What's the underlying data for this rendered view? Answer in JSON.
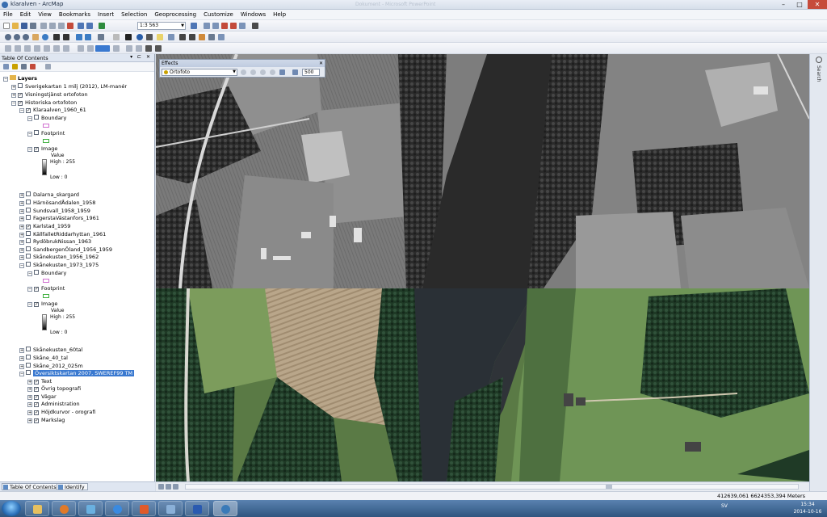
{
  "window": {
    "title": "klaralven - ArcMap",
    "ghost_title": "Dokument - Microsoft PowerPoint"
  },
  "menu": [
    "File",
    "Edit",
    "View",
    "Bookmarks",
    "Insert",
    "Selection",
    "Geoprocessing",
    "Customize",
    "Windows",
    "Help"
  ],
  "toolbar": {
    "scale": "1:3 563"
  },
  "toc": {
    "title": "Table Of Contents",
    "root": "Layers",
    "items": [
      {
        "label": "Sverigekartan 1 milj (2012), LM-manér",
        "checked": false
      },
      {
        "label": "Visningstjänst ortofoton",
        "checked": true
      },
      {
        "label": "Historiska ortofoton",
        "checked": true
      },
      {
        "label": "Klaraalven_1960_61",
        "checked": true
      },
      {
        "label": "Boundary",
        "checked": false
      },
      {
        "label": "Footprint",
        "checked": false
      },
      {
        "label": "Image",
        "checked": true
      },
      {
        "label": "Dalarna_skargard",
        "checked": false
      },
      {
        "label": "HärnösandÅdalen_1958",
        "checked": false
      },
      {
        "label": "Sundsvall_1958_1959",
        "checked": false
      },
      {
        "label": "FagerstaVästanfors_1961",
        "checked": false
      },
      {
        "label": "Karlstad_1959",
        "checked": true
      },
      {
        "label": "KällfalletRiddarhyttan_1961",
        "checked": false
      },
      {
        "label": "RydöbrukNissan_1963",
        "checked": false
      },
      {
        "label": "SandbergenÖland_1956_1959",
        "checked": false
      },
      {
        "label": "Skånekusten_1956_1962",
        "checked": false
      },
      {
        "label": "Skånekusten_1973_1975",
        "checked": false
      },
      {
        "label": "Boundary",
        "checked": false
      },
      {
        "label": "Footprint",
        "checked": true
      },
      {
        "label": "Image",
        "checked": true
      },
      {
        "label": "Skånekusten_60tal",
        "checked": false
      },
      {
        "label": "Skåne_40_tal",
        "checked": false
      },
      {
        "label": "Skåne_2012_025m",
        "checked": false
      },
      {
        "label": "Översiktskartan 2007, SWEREF99 TM",
        "checked": false
      },
      {
        "label": "Text",
        "checked": true
      },
      {
        "label": "Övrig topografi",
        "checked": true
      },
      {
        "label": "Vägar",
        "checked": true
      },
      {
        "label": "Administration",
        "checked": true
      },
      {
        "label": "Höjdkurvor - orografi",
        "checked": true
      },
      {
        "label": "Markslag",
        "checked": true
      }
    ],
    "legend": {
      "value": "Value",
      "high": "High : 255",
      "low": "Low : 0"
    },
    "tabs": [
      "Table Of Contents",
      "Identify"
    ]
  },
  "effects": {
    "title": "Effects",
    "layer": "Ortofoto",
    "value": "500"
  },
  "right_panel": {
    "label": "Search"
  },
  "status": {
    "coordinates": "412639,061  6624353,394 Meters"
  },
  "taskbar": {
    "lang": "SV",
    "time": "15:34",
    "date": "2014-10-16"
  },
  "colors": {
    "selection": "#3a79d0",
    "boundary_symbol": "#d070d0",
    "footprint_symbol": "#40b040"
  }
}
